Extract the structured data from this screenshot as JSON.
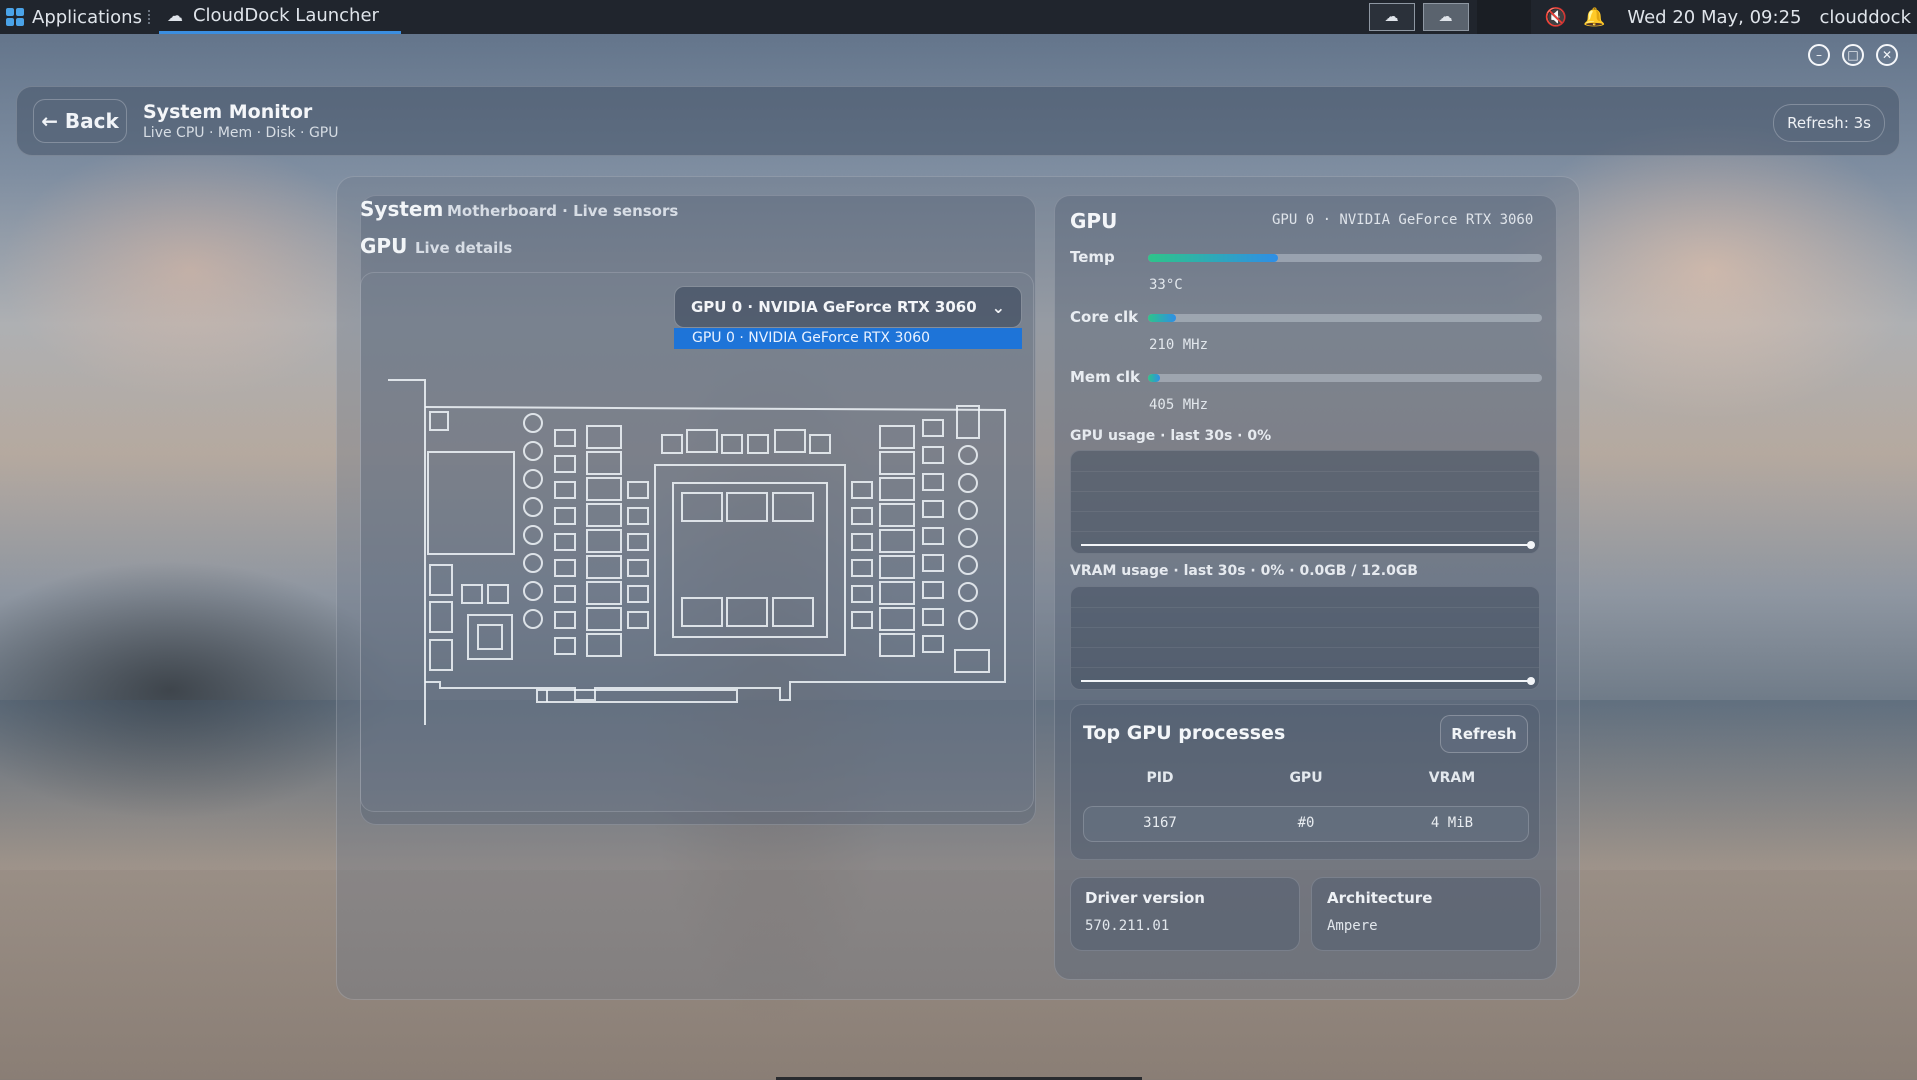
{
  "taskbar": {
    "apps_label": "Applications",
    "active_task": "CloudDock Launcher",
    "clock": "Wed 20 May, 09:25",
    "user": "clouddock"
  },
  "header": {
    "back_label": "← Back",
    "title": "System Monitor",
    "subtitle": "Live CPU · Mem · Disk · GPU",
    "refresh_label": "Refresh: 3s"
  },
  "left": {
    "section1_title": "System",
    "section1_sub": "Motherboard · Live sensors",
    "section2_title": "GPU",
    "section2_sub": "Live details",
    "gpu_select": {
      "selected": "GPU 0 · NVIDIA GeForce RTX 3060",
      "options": [
        "GPU 0 · NVIDIA GeForce RTX 3060"
      ]
    }
  },
  "gpu": {
    "title": "GPU",
    "model": "GPU 0 · NVIDIA GeForce RTX 3060",
    "metrics": [
      {
        "label": "Temp",
        "value": "33°C",
        "fraction": 0.33
      },
      {
        "label": "Core clk",
        "value": "210 MHz",
        "fraction": 0.07
      },
      {
        "label": "Mem clk",
        "value": "405 MHz",
        "fraction": 0.03
      }
    ],
    "usage_label": "GPU usage · last 30s · 0%",
    "vram_label": "VRAM usage · last 30s · 0% · 0.0GB / 12.0GB",
    "processes": {
      "title": "Top GPU processes",
      "refresh_label": "Refresh",
      "columns": [
        "PID",
        "GPU",
        "VRAM"
      ],
      "rows": [
        {
          "pid": "3167",
          "gpu": "#0",
          "vram": "4 MiB"
        }
      ]
    },
    "driver": {
      "label": "Driver version",
      "value": "570.211.01"
    },
    "architecture": {
      "label": "Architecture",
      "value": "Ampere"
    }
  },
  "colors": {
    "accent": "#1e74d8",
    "bar_start": "#2ec48a",
    "bar_end": "#2f8ee6",
    "taskbar": "#20252d"
  },
  "icons": {
    "apps": "grid-icon",
    "launcher": "cloud-icon",
    "mute": "mute-icon",
    "notifications": "bell-icon",
    "dropdown": "chevron-down-icon"
  }
}
